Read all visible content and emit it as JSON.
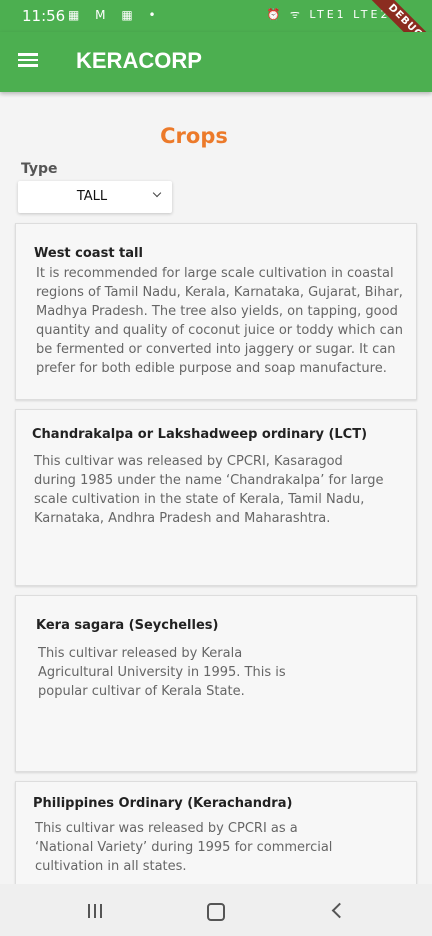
{
  "status_bar": {
    "time": "11:56",
    "left_icons": "▦ M ▦ •",
    "right_icons": "⏰ ᯤ LTE1 LTE2 ▮",
    "debug_label": "DEBUG"
  },
  "app_bar": {
    "menu_icon": "hamburger-menu",
    "title": "KERACORP"
  },
  "page": {
    "title": "Crops",
    "type_label": "Type",
    "type_value": "TALL"
  },
  "crops": [
    {
      "name": "West coast tall",
      "description": "It is recommended for large scale cultivation in coastal regions of Tamil Nadu, Kerala, Karnataka, Gujarat, Bihar, Madhya Pradesh. The tree also yields, on tapping, good quantity and quality of coconut juice or toddy which can be fermented or converted into jaggery or sugar. It can prefer for both edible purpose and soap manufacture."
    },
    {
      "name": "Chandrakalpa or Lakshadweep ordinary (LCT)",
      "description": "This cultivar was released by CPCRI, Kasaragod during 1985 under the name ‘Chandrakalpa’ for large scale cultivation in the state of Kerala, Tamil Nadu, Karnataka, Andhra Pradesh and Maharashtra."
    },
    {
      "name": "Kera sagara (Seychelles)",
      "description": "This cultivar released by Kerala Agricultural University in 1995. This is popular cultivar of Kerala State."
    },
    {
      "name": "Philippines Ordinary (Kerachandra)",
      "description": "This cultivar was released by CPCRI as a ‘National Variety’ during 1995 for commercial cultivation in all states."
    }
  ],
  "nav_bar": {
    "recent_icon": "recent-apps",
    "home_icon": "home",
    "back_icon": "back"
  }
}
